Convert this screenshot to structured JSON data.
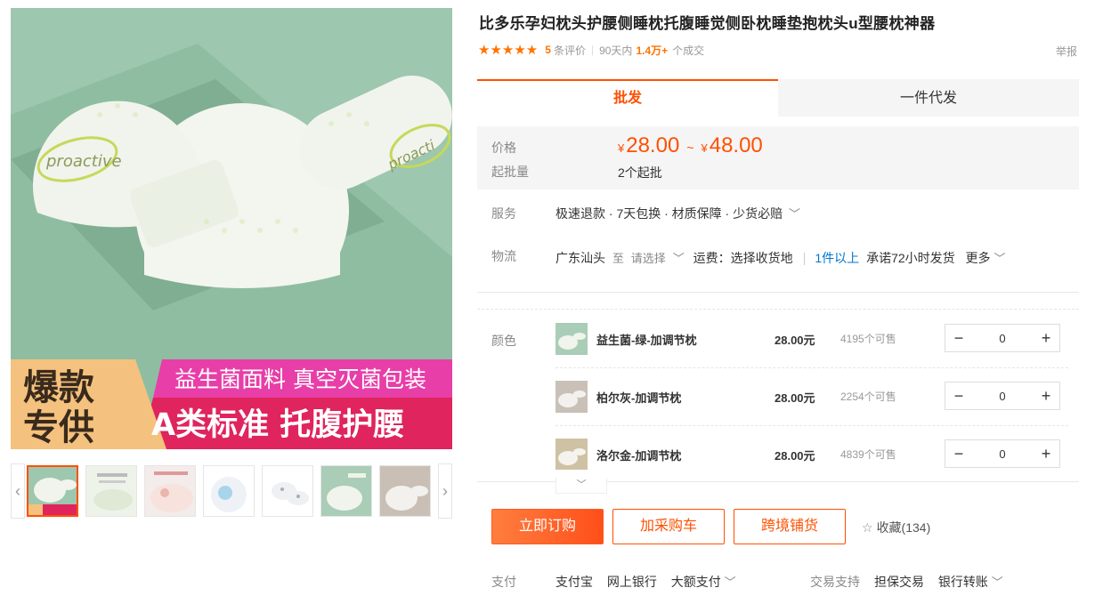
{
  "product": {
    "title": "比多乐孕妇枕头护腰侧睡枕托腹睡觉侧卧枕睡垫抱枕头u型腰枕神器",
    "stars": "★★★★★",
    "review_count": "5",
    "review_label": "条评价",
    "sales_period": "90天内",
    "sales_count": "1.4万+",
    "sales_label": "个成交",
    "report": "举报"
  },
  "gallery": {
    "logo_text": "proactive",
    "banner_top": "益生菌面料 真空灭菌包装",
    "banner_bottom": "A类标准 托腹护腰",
    "badge_line1": "爆款",
    "badge_line2": "专供",
    "prev_arrow": "‹",
    "next_arrow": "›",
    "thumbnails": [
      "thumb-1",
      "thumb-2",
      "thumb-3",
      "thumb-4",
      "thumb-5",
      "thumb-6",
      "thumb-7",
      "thumb-8"
    ]
  },
  "tabs": [
    {
      "label": "批发",
      "active": true
    },
    {
      "label": "一件代发",
      "active": false
    }
  ],
  "pricing": {
    "price_label": "价格",
    "currency": "¥",
    "min": "28.00",
    "tilde": "~",
    "max": "48.00",
    "moq_label": "起批量",
    "moq_value": "2个起批"
  },
  "service": {
    "label": "服务",
    "value": "极速退款 · 7天包换 · 材质保障 · 少货必赔"
  },
  "logistics": {
    "label": "物流",
    "origin": "广东汕头",
    "to": "至",
    "select": "请选择",
    "freight": "运费：选择收货地",
    "qty": "1件以上",
    "promise": "承诺72小时发货",
    "more": "更多"
  },
  "sku": {
    "label": "颜色",
    "items": [
      {
        "name": "益生菌-绿-加调节枕",
        "price": "28.00元",
        "stock": "4195个可售",
        "qty": "0",
        "color": "#a9cdb6"
      },
      {
        "name": "柏尔灰-加调节枕",
        "price": "28.00元",
        "stock": "2254个可售",
        "qty": "0",
        "color": "#c9c1b7"
      },
      {
        "name": "洛尔金-加调节枕",
        "price": "28.00元",
        "stock": "4839个可售",
        "qty": "0",
        "color": "#cfc1a3"
      }
    ],
    "minus": "−",
    "plus": "+",
    "expand": "﹀"
  },
  "actions": {
    "buy": "立即订购",
    "cart": "加采购车",
    "cross": "跨境铺货",
    "favorite": "收藏(134)"
  },
  "payment": {
    "label": "支付",
    "methods": [
      "支付宝",
      "网上银行",
      "大额支付"
    ],
    "trade_label": "交易支持",
    "trade_methods": [
      "担保交易",
      "银行转账"
    ]
  },
  "colors": {
    "accent": "#ff5000",
    "star": "#ff7300",
    "link": "#0076ce"
  }
}
